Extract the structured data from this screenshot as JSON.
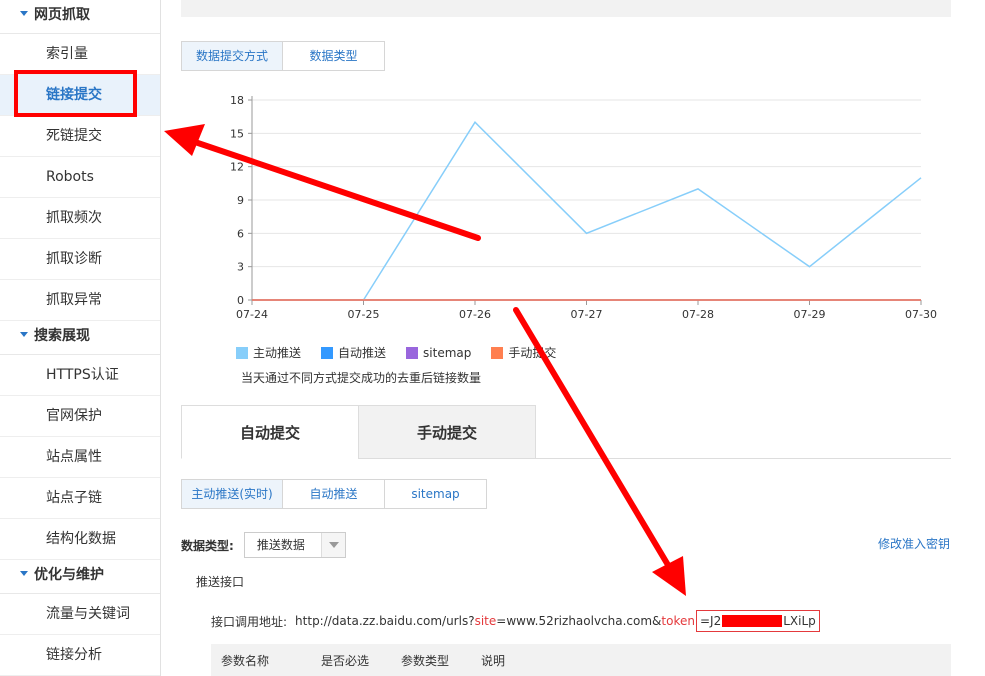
{
  "sidebar": {
    "groups": [
      {
        "label": "网页抓取",
        "items": [
          "索引量",
          "链接提交",
          "死链提交",
          "Robots",
          "抓取频次",
          "抓取诊断",
          "抓取异常"
        ]
      },
      {
        "label": "搜索展现",
        "items": [
          "HTTPS认证",
          "官网保护",
          "站点属性",
          "站点子链",
          "结构化数据"
        ]
      },
      {
        "label": "优化与维护",
        "items": [
          "流量与关键词",
          "链接分析"
        ]
      }
    ],
    "active_item": "链接提交"
  },
  "top_tabs": [
    "数据提交方式",
    "数据类型"
  ],
  "chart_data": {
    "type": "line",
    "categories": [
      "07-24",
      "07-25",
      "07-26",
      "07-27",
      "07-28",
      "07-29",
      "07-30"
    ],
    "y_ticks": [
      "18",
      "15",
      "12",
      "9",
      "6",
      "3",
      "0"
    ],
    "ylim": [
      0,
      18
    ],
    "series": [
      {
        "name": "主动推送",
        "color": "#87cefa",
        "values": [
          null,
          0,
          16,
          6,
          10,
          3,
          11
        ]
      },
      {
        "name": "自动推送",
        "color": "#3399ff",
        "values": [
          0,
          0,
          0,
          0,
          0,
          0,
          0
        ]
      },
      {
        "name": "sitemap",
        "color": "#9966dd",
        "values": [
          0,
          0,
          0,
          0,
          0,
          0,
          0
        ]
      },
      {
        "name": "手动提交",
        "color": "#ff7f50",
        "values": [
          0,
          0,
          0,
          0,
          0,
          0,
          0
        ]
      }
    ],
    "note": "当天通过不同方式提交成功的去重后链接数量"
  },
  "big_tabs": {
    "active": "自动提交",
    "inactive": "手动提交"
  },
  "sub_tabs": [
    "主动推送(实时)",
    "自动推送",
    "sitemap"
  ],
  "data_type": {
    "label": "数据类型:",
    "value": "推送数据"
  },
  "modify_key_link": "修改准入密钥",
  "push_api": {
    "title": "推送接口",
    "url_label": "接口调用地址:",
    "url_prefix": "http://data.zz.baidu.com/urls?",
    "site_key": "site",
    "site_value": "=www.52rizhaolvcha.com&",
    "token_key": "token",
    "token_start": "=J2",
    "token_end": "LXiLp"
  },
  "param_table": {
    "headers": [
      "参数名称",
      "是否必选",
      "参数类型",
      "说明"
    ]
  }
}
